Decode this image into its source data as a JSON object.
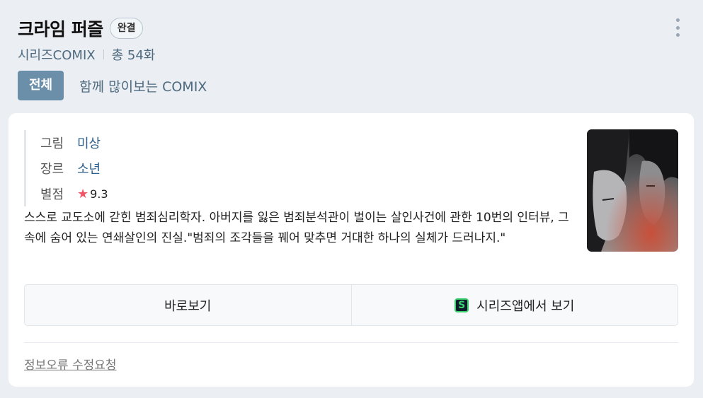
{
  "header": {
    "title": "크라임 퍼즐",
    "status_badge": "완결",
    "publisher": "시리즈COMIX",
    "episodes": "총 54화"
  },
  "tabs": [
    {
      "label": "전체",
      "active": true
    },
    {
      "label": "함께 많이보는 COMIX",
      "active": false
    }
  ],
  "info": {
    "art_label": "그림",
    "art_value": "미상",
    "genre_label": "장르",
    "genre_value": "소년",
    "rating_label": "별점",
    "rating_value": "9.3"
  },
  "description": "스스로 교도소에 갇힌 범죄심리학자. 아버지를 잃은 범죄분석관이 벌이는 살인사건에 관한 10번의 인터뷰, 그 속에 숨어 있는 연쇄살인의 진실.\"범죄의 조각들을 꿰어 맞추면 거대한 하나의 실체가 드러나지.\"",
  "actions": {
    "view_now": "바로보기",
    "view_in_app": "시리즈앱에서 보기"
  },
  "report_link": "정보오류 수정요청",
  "colors": {
    "accent": "#6b8ea9",
    "link": "#2d5f8b",
    "star": "#f05565",
    "app_icon_green": "#3bd16f"
  }
}
